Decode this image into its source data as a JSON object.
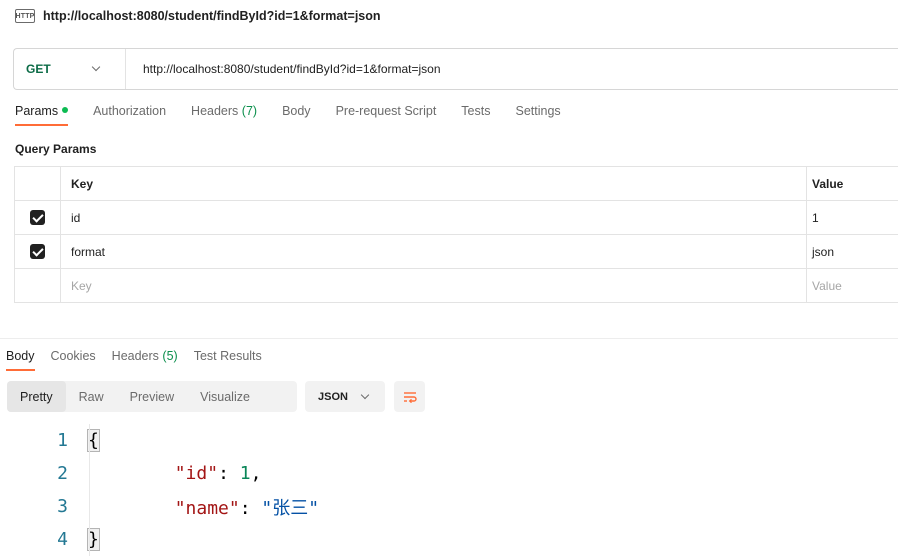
{
  "tab": {
    "icon": "http-file-icon",
    "icon_text": "HTTP",
    "title": "http://localhost:8080/student/findById?id=1&format=json"
  },
  "request": {
    "method": "GET",
    "url": "http://localhost:8080/student/findById?id=1&format=json"
  },
  "request_tabs": [
    {
      "label": "Params",
      "active": true,
      "indicator": "green-dot"
    },
    {
      "label": "Authorization"
    },
    {
      "label": "Headers",
      "count": "(7)"
    },
    {
      "label": "Body"
    },
    {
      "label": "Pre-request Script"
    },
    {
      "label": "Tests"
    },
    {
      "label": "Settings"
    }
  ],
  "query_params": {
    "title": "Query Params",
    "columns": [
      "Key",
      "Value"
    ],
    "rows": [
      {
        "checked": true,
        "key": "id",
        "value": "1"
      },
      {
        "checked": true,
        "key": "format",
        "value": "json"
      }
    ],
    "placeholder": {
      "key": "Key",
      "value": "Value"
    }
  },
  "response_tabs": [
    {
      "label": "Body",
      "active": true
    },
    {
      "label": "Cookies"
    },
    {
      "label": "Headers",
      "count": "(5)"
    },
    {
      "label": "Test Results"
    }
  ],
  "view_modes": [
    "Pretty",
    "Raw",
    "Preview",
    "Visualize"
  ],
  "active_view": "Pretty",
  "format": "JSON",
  "code": {
    "line_numbers": [
      "1",
      "2",
      "3",
      "4"
    ],
    "open_brace": "{",
    "close_brace": "}",
    "entries": [
      {
        "key": "\"id\"",
        "value": "1",
        "value_type": "number",
        "trailing": ","
      },
      {
        "key": "\"name\"",
        "value": "\"张三\"",
        "value_type": "string",
        "trailing": ""
      }
    ]
  },
  "colors": {
    "accent": "#ff6c37",
    "method": "#0b6b46",
    "count": "#0b8f4c",
    "dot": "#0cbb52"
  }
}
